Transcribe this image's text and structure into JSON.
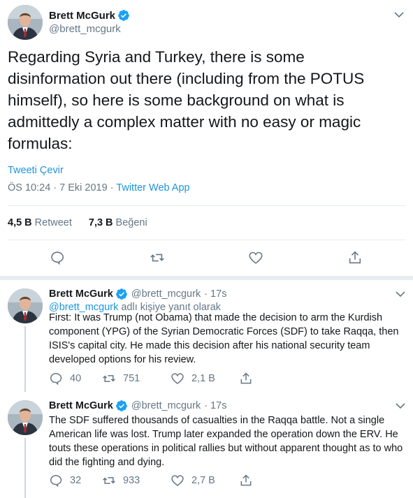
{
  "main_tweet": {
    "display_name": "Brett McGurk",
    "handle": "@brett_mcgurk",
    "text": "Regarding Syria and Turkey, there is some disinformation out there (including from the POTUS himself), so here is some background on what is admittedly a complex matter with no easy or magic formulas:",
    "translate_label": "Tweeti Çevir",
    "time": "ÖS 10:24 · 7 Eki 2019 · ",
    "app": "Twitter Web App",
    "retweet_count": "4,5 B",
    "retweet_label": "Retweet",
    "like_count": "7,3 B",
    "like_label": "Beğeni"
  },
  "replies": [
    {
      "display_name": "Brett McGurk",
      "handle": "@brett_mcgurk",
      "time": "· 17s",
      "reply_to_mention": "@brett_mcgurk",
      "reply_to_suffix": " adlı kişiye yanıt olarak",
      "text": "First: It was Trump (not Obama) that made the decision to arm the Kurdish component (YPG) of the Syrian Democratic Forces (SDF) to take Raqqa, then ISIS's capital city. He made this decision after his national security team developed options for his review.",
      "replies": "40",
      "retweets": "751",
      "likes": "2,1 B"
    },
    {
      "display_name": "Brett McGurk",
      "handle": "@brett_mcgurk",
      "time": "· 17s",
      "text": "The SDF suffered thousands of casualties in the Raqqa battle. Not a single American life was lost. Trump later expanded the operation down the ERV. He touts these operations in political rallies but without apparent thought as to who did the fighting and dying.",
      "replies": "32",
      "retweets": "933",
      "likes": "2,7 B"
    }
  ],
  "colors": {
    "link": "#1b95e0",
    "muted": "#657786",
    "text": "#14171a",
    "divider": "#e6ecf0"
  },
  "icons": [
    "verified-badge-icon",
    "chevron-down-icon",
    "reply-icon",
    "retweet-icon",
    "like-icon",
    "share-icon"
  ]
}
